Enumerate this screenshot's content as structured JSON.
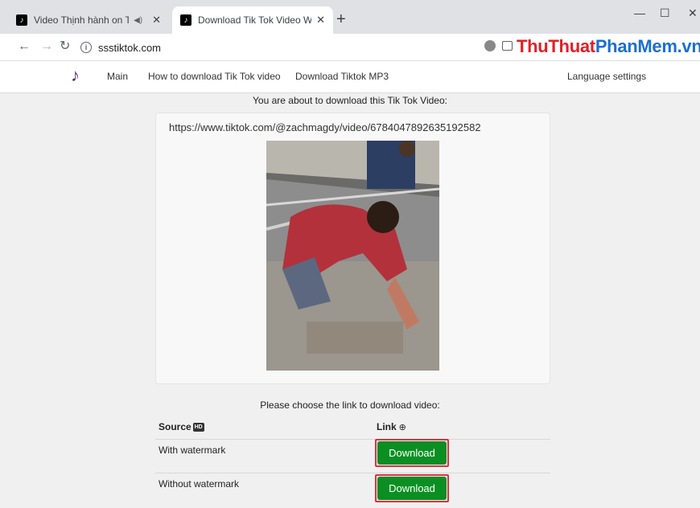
{
  "browser": {
    "tabs": [
      {
        "title": "Video Thịnh hành on TikTok",
        "favicon": "tiktok-icon",
        "audio": true,
        "active": false
      },
      {
        "title": "Download Tik Tok Video Without Watermark",
        "favicon": "ssstiktok-icon",
        "audio": false,
        "active": true
      }
    ],
    "new_tab_label": "+",
    "url": "ssstiktok.com",
    "watermark_brand": {
      "part1": "Thu",
      "part2": "Thuat",
      "part3": "PhanMem",
      "part4": ".vn"
    }
  },
  "site": {
    "nav": {
      "main": "Main",
      "howto": "How to download Tik Tok video",
      "mp3": "Download Tiktok MP3",
      "language": "Language settings"
    },
    "about_heading": "You are about to download this Tik Tok Video:",
    "video_url": "https://www.tiktok.com/@zachmagdy/video/6784047892635192582",
    "choose_heading": "Please choose the link to download video:",
    "table": {
      "source_header": "Source",
      "link_header": "Link",
      "rows": [
        {
          "source": "With watermark",
          "button": "Download"
        },
        {
          "source": "Without watermark",
          "button": "Download"
        }
      ]
    }
  },
  "colors": {
    "download_button": "#0b8f22",
    "highlight_border": "#e03040",
    "brand_red": "#e31e24",
    "brand_blue": "#1a6fd1"
  }
}
